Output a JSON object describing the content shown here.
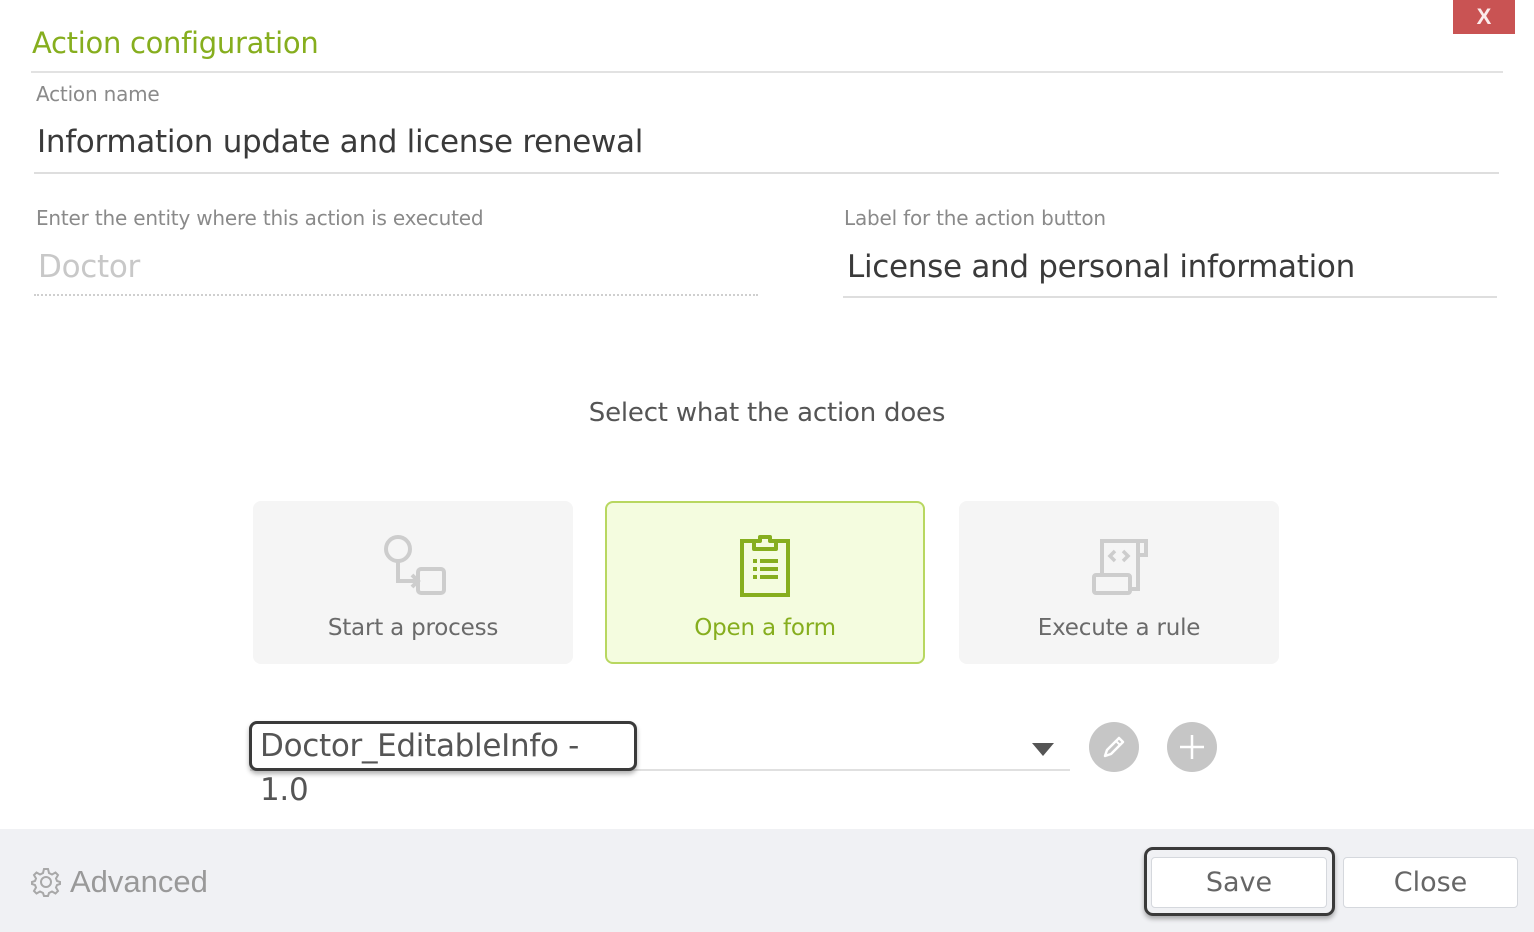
{
  "dialog": {
    "title": "Action configuration",
    "close_x_label": "X"
  },
  "fields": {
    "action_name": {
      "label": "Action name",
      "value": "Information update and license renewal"
    },
    "entity": {
      "label": "Enter the entity where this action is executed",
      "value": "Doctor"
    },
    "button_label": {
      "label": "Label for the action button",
      "value": "License and personal information"
    }
  },
  "action_type": {
    "prompt": "Select what the action does",
    "options": [
      {
        "label": "Start a process",
        "icon": "process-flow-icon",
        "selected": false
      },
      {
        "label": "Open a form",
        "icon": "clipboard-form-icon",
        "selected": true
      },
      {
        "label": "Execute a rule",
        "icon": "script-rule-icon",
        "selected": false
      }
    ]
  },
  "form_select": {
    "value": "Doctor_EditableInfo - 1.0",
    "edit_icon": "pencil-icon",
    "add_icon": "plus-icon"
  },
  "footer": {
    "advanced_label": "Advanced",
    "save_label": "Save",
    "close_label": "Close"
  },
  "colors": {
    "accent": "#86ae1e",
    "selected_bg": "#f4fcdf",
    "close_x_bg": "#c95353",
    "footer_bg": "#f0f1f4"
  }
}
